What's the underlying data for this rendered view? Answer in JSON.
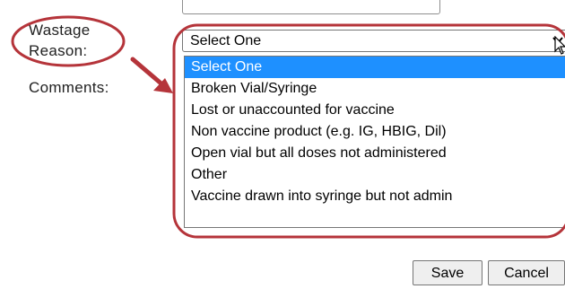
{
  "form": {
    "wastage_label_line1": "Wastage",
    "wastage_label_line2": "Reason:",
    "comments_label": "Comments:"
  },
  "select": {
    "selected_value": "Select One",
    "options": [
      "Select One",
      "Broken Vial/Syringe",
      "Lost or unaccounted for vaccine",
      "Non vaccine product (e.g. IG, HBIG, Dil)",
      "Open vial but all doses not administered",
      "Other",
      "Vaccine drawn into syringe but not admin"
    ]
  },
  "buttons": {
    "save_label": "Save",
    "cancel_label": "Cancel"
  },
  "colors": {
    "highlight": "#1e90ff",
    "annotation": "#b5343a"
  },
  "icons": {
    "select_arrow": "chevron-down-icon",
    "cursor": "mouse-cursor-icon"
  }
}
